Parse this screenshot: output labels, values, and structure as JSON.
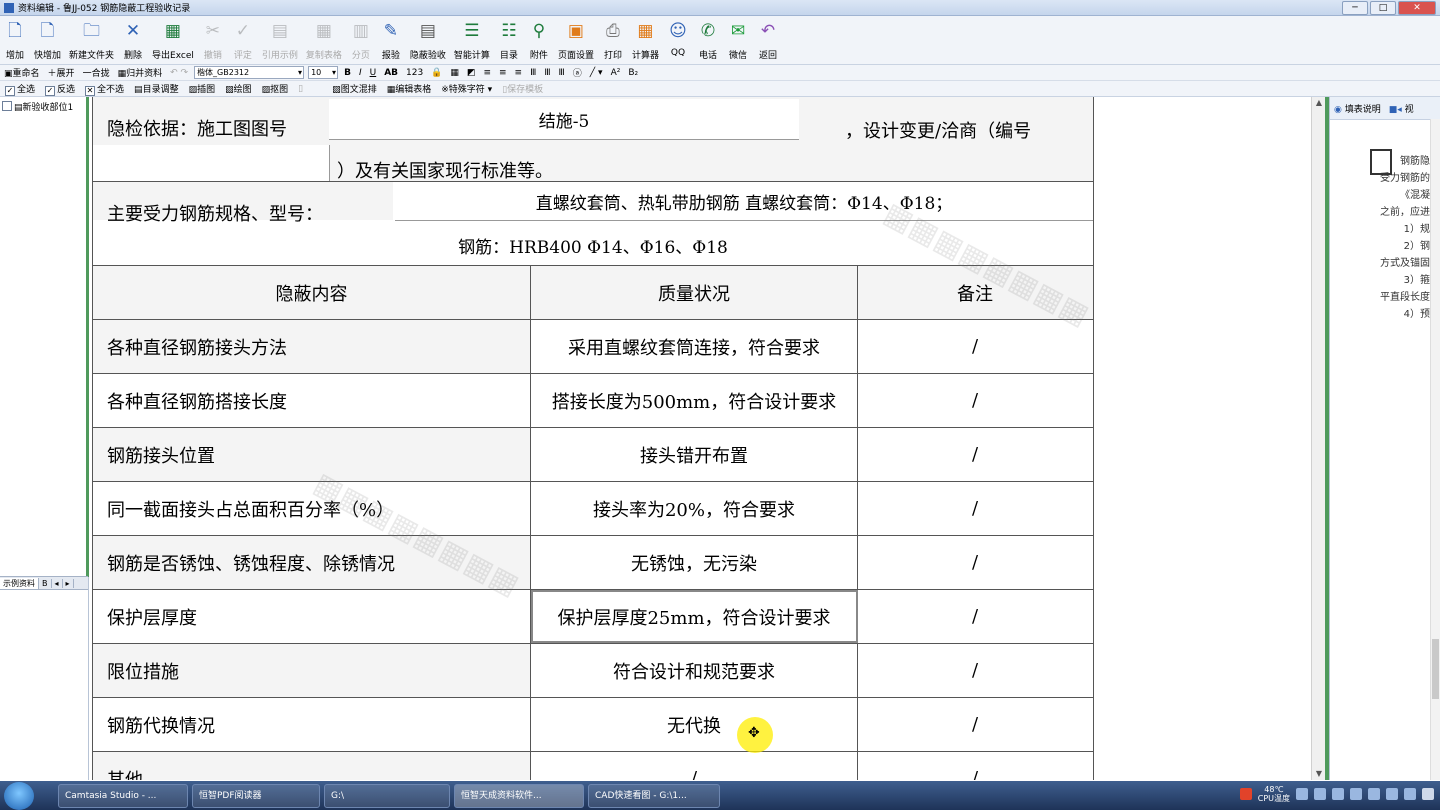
{
  "window": {
    "title": "资料编辑 - 鲁JJ-052 钢筋隐蔽工程验收记录"
  },
  "toolbar": [
    {
      "label": "增加",
      "icon": "new-doc-icon",
      "enabled": true
    },
    {
      "label": "快增加",
      "icon": "quick-add-icon",
      "enabled": true
    },
    {
      "label": "新建文件夹",
      "icon": "folder-icon",
      "enabled": true
    },
    {
      "label": "删除",
      "icon": "delete-x-icon",
      "enabled": true
    },
    {
      "label": "导出Excel",
      "icon": "excel-icon",
      "enabled": true
    },
    {
      "label": "撤销",
      "icon": "cut-icon",
      "enabled": false
    },
    {
      "label": "评定",
      "icon": "check-icon",
      "enabled": false
    },
    {
      "label": "引用示例",
      "icon": "doc-ref-icon",
      "enabled": false
    },
    {
      "label": "复制表格",
      "icon": "copy-table-icon",
      "enabled": false
    },
    {
      "label": "分页",
      "icon": "split-icon",
      "enabled": false
    },
    {
      "label": "报验",
      "icon": "report-icon",
      "enabled": true
    },
    {
      "label": "隐蔽验收",
      "icon": "hidden-check-icon",
      "enabled": true
    },
    {
      "label": "智能计算",
      "icon": "calc-stack-icon",
      "enabled": true
    },
    {
      "label": "目录",
      "icon": "list-icon",
      "enabled": true
    },
    {
      "label": "附件",
      "icon": "paperclip-icon",
      "enabled": true
    },
    {
      "label": "页面设置",
      "icon": "page-setup-icon",
      "enabled": true
    },
    {
      "label": "打印",
      "icon": "printer-icon",
      "enabled": true
    },
    {
      "label": "计算器",
      "icon": "calculator-icon",
      "enabled": true
    },
    {
      "label": "QQ",
      "icon": "qq-icon",
      "enabled": true
    },
    {
      "label": "电话",
      "icon": "phone-icon",
      "enabled": true
    },
    {
      "label": "微信",
      "icon": "wechat-icon",
      "enabled": true
    },
    {
      "label": "返回",
      "icon": "back-arrow-icon",
      "enabled": true
    }
  ],
  "fmtbar": {
    "rename": "重命名",
    "expand": "展开",
    "merge": "一合拢",
    "archive": "归并资料",
    "font": "楷体_GB2312",
    "size": "10",
    "bold": "B",
    "italic": "I",
    "underline": "U",
    "ab": "AB",
    "num": "123",
    "superscript": "A²",
    "subscript": "B₂",
    "circle": "ⓐ"
  },
  "optbar": {
    "selectAll": "全选",
    "invert": "反选",
    "selectNone": "全不选",
    "dirAdjust": "目录调整",
    "insertImage": "插图",
    "drawImage": "绘图",
    "cropImage": "抠图",
    "graphicText": "图文混排",
    "editTable": "编辑表格",
    "specialChar": "特殊字符",
    "saveTemplate": "保存模板"
  },
  "tree": {
    "root": "新验收部位1"
  },
  "leftTabs": [
    "示例资料",
    "B"
  ],
  "rightPanel": {
    "tab1": "填表说明",
    "tab2": "视",
    "lines": [
      "钢筋隐",
      "受力钢筋的",
      "《混凝",
      "之前，应进",
      "1）规",
      "2）钢",
      "方式及锚固",
      "3）箍",
      "平直段长度",
      "4）预"
    ]
  },
  "doc": {
    "basisLabel": "隐检依据：施工图图号",
    "drawingNo": "结施-5",
    "changeLabel": "，设计变更/洽商（编号",
    "standardsLabel": "）及有关国家现行标准等。",
    "specLabel": "主要受力钢筋规格、型号：",
    "specValue1": "直螺纹套筒、热轧带肋钢筋  直螺纹套筒：Φ14、Φ18；",
    "specValue2": "钢筋：HRB400 Φ14、Φ16、Φ18",
    "headers": [
      "隐蔽内容",
      "质量状况",
      "备注"
    ],
    "rows": [
      {
        "item": "各种直径钢筋接头方法",
        "status": "采用直螺纹套筒连接，符合要求",
        "note": "/"
      },
      {
        "item": "各种直径钢筋搭接长度",
        "status": "搭接长度为500mm，符合设计要求",
        "note": "/"
      },
      {
        "item": "钢筋接头位置",
        "status": "接头错开布置",
        "note": "/"
      },
      {
        "item": "同一截面接头占总面积百分率（%）",
        "status": "接头率为20%，符合要求",
        "note": "/"
      },
      {
        "item": "钢筋是否锈蚀、锈蚀程度、除锈情况",
        "status": "无锈蚀，无污染",
        "note": "/"
      },
      {
        "item": "保护层厚度",
        "status": "保护层厚度25mm，符合设计要求",
        "note": "/"
      },
      {
        "item": "限位措施",
        "status": "符合设计和规范要求",
        "note": "/"
      },
      {
        "item": "钢筋代换情况",
        "status": "无代换",
        "note": "/"
      },
      {
        "item": "其他",
        "status": "/",
        "note": "/"
      }
    ]
  },
  "taskbar": {
    "items": [
      "Camtasia Studio - ...",
      "恒智PDF阅读器",
      "G:\\",
      "恒智天成资料软件...",
      "CAD快速看图 - G:\\1..."
    ],
    "temp": "48℃",
    "tempLabel": "CPU温度"
  }
}
